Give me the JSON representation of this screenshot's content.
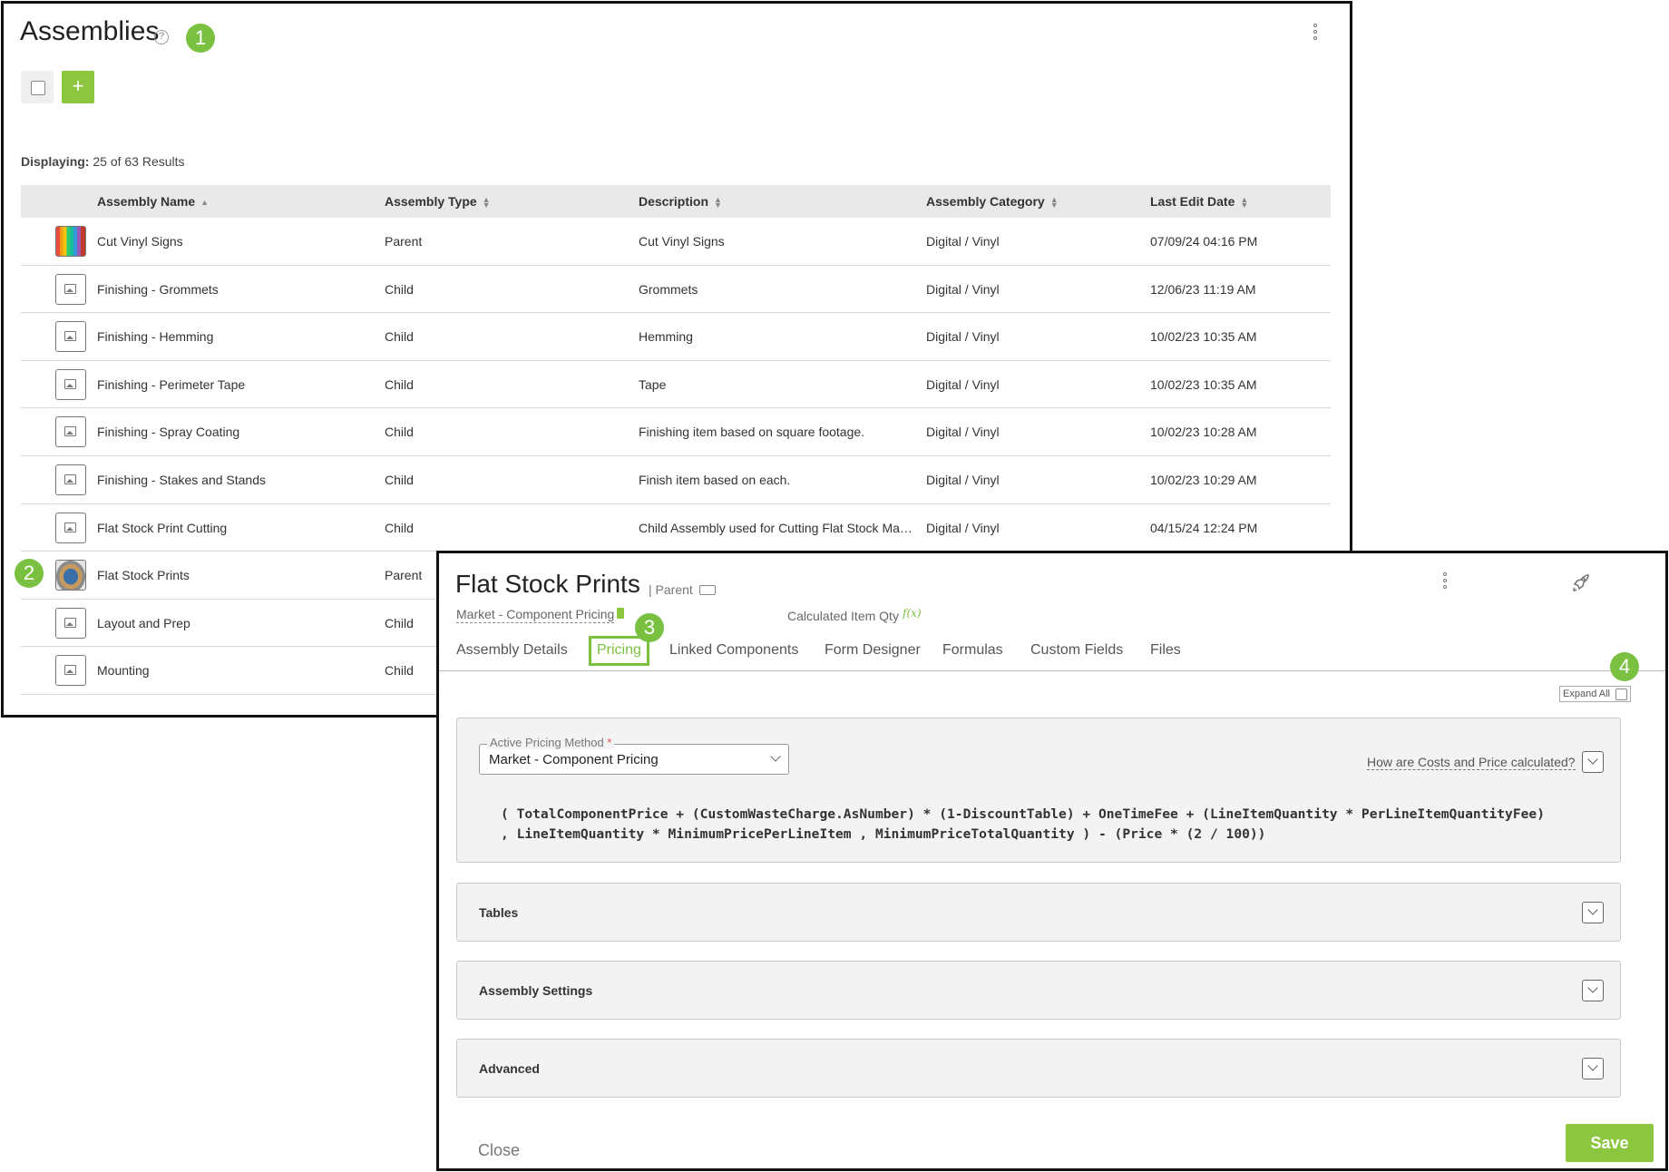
{
  "list": {
    "title": "Assemblies",
    "help_glyph": "?",
    "callout_1": "1",
    "add_glyph": "+",
    "displaying_label": "Displaying:",
    "displaying_value": "25 of 63 Results",
    "columns": [
      "Assembly Name",
      "Assembly Type",
      "Description",
      "Assembly Category",
      "Last Edit Date"
    ],
    "rows": [
      {
        "name": "Cut Vinyl Signs",
        "type": "Parent",
        "description": "Cut Vinyl Signs",
        "category": "Digital / Vinyl",
        "date": "07/09/24 04:16 PM",
        "thumb": "colorful"
      },
      {
        "name": "Finishing - Grommets",
        "type": "Child",
        "description": "Grommets",
        "category": "Digital / Vinyl",
        "date": "12/06/23 11:19 AM",
        "thumb": "image-icon"
      },
      {
        "name": "Finishing - Hemming",
        "type": "Child",
        "description": "Hemming",
        "category": "Digital / Vinyl",
        "date": "10/02/23 10:35 AM",
        "thumb": "image-icon"
      },
      {
        "name": "Finishing - Perimeter Tape",
        "type": "Child",
        "description": "Tape",
        "category": "Digital / Vinyl",
        "date": "10/02/23 10:35 AM",
        "thumb": "image-icon"
      },
      {
        "name": "Finishing - Spray Coating",
        "type": "Child",
        "description": "Finishing item based on square footage.",
        "category": "Digital / Vinyl",
        "date": "10/02/23 10:28 AM",
        "thumb": "image-icon"
      },
      {
        "name": "Finishing - Stakes and Stands",
        "type": "Child",
        "description": "Finish item based on each.",
        "category": "Digital / Vinyl",
        "date": "10/02/23 10:29 AM",
        "thumb": "image-icon"
      },
      {
        "name": "Flat Stock Print Cutting",
        "type": "Child",
        "description": "Child Assembly used for Cutting Flat Stock Mate...",
        "category": "Digital / Vinyl",
        "date": "04/15/24 12:24 PM",
        "thumb": "image-icon"
      },
      {
        "name": "Flat Stock Prints",
        "type": "Parent",
        "description": "",
        "category": "",
        "date": "",
        "thumb": "photo",
        "callout": "2"
      },
      {
        "name": "Layout and Prep",
        "type": "Child",
        "description": "",
        "category": "",
        "date": "",
        "thumb": "image-icon"
      },
      {
        "name": "Mounting",
        "type": "Child",
        "description": "",
        "category": "",
        "date": "",
        "thumb": "image-icon"
      }
    ]
  },
  "detail": {
    "title": "Flat Stock Prints",
    "type_label": "| Parent",
    "pricing_method_link": "Market - Component Pricing",
    "calculated_qty_label": "Calculated Item Qty",
    "fx_glyph": "f(x)",
    "callout_3": "3",
    "callout_4": "4",
    "tabs": [
      "Assembly Details",
      "Pricing",
      "Linked Components",
      "Form Designer",
      "Formulas",
      "Custom Fields",
      "Files"
    ],
    "active_tab": "Pricing",
    "expand_all": "Expand All",
    "active_pricing_label": "Active Pricing Method",
    "required_mark": "*",
    "active_pricing_value": "Market - Component Pricing",
    "how_link": "How are Costs and Price calculated?",
    "formula_line1": "( TotalComponentPrice + (CustomWasteCharge.AsNumber) * (1-DiscountTable) + OneTimeFee + (LineItemQuantity * PerLineItemQuantityFee)",
    "formula_line2": ", LineItemQuantity * MinimumPricePerLineItem , MinimumPriceTotalQuantity ) - (Price * (2 / 100))",
    "sections": [
      "Tables",
      "Assembly Settings",
      "Advanced"
    ],
    "close_label": "Close",
    "save_label": "Save"
  },
  "colors": {
    "accent": "#8cc63f",
    "callout": "#7ac142"
  }
}
